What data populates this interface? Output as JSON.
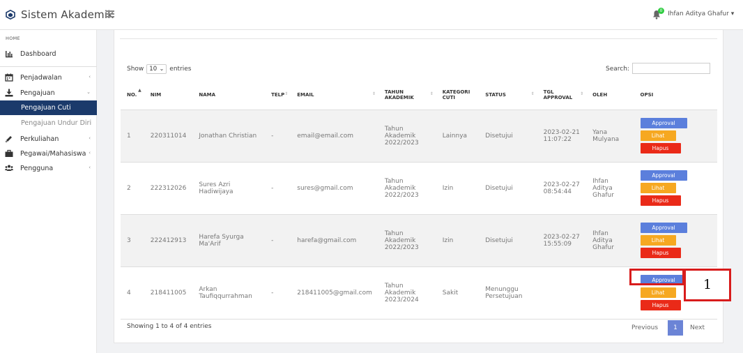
{
  "app": {
    "title": "Sistem Akademik",
    "brand_color": "#1b3a6b"
  },
  "user": {
    "name": "Ihfan Aditya Ghafur",
    "notification_count": "0"
  },
  "sidebar": {
    "heading": "HOME",
    "items": [
      {
        "label": "Dashboard",
        "icon": "bar-chart-icon"
      },
      {
        "label": "Penjadwalan",
        "icon": "calendar-icon"
      },
      {
        "label": "Pengajuan",
        "icon": "download-icon"
      },
      {
        "label": "Pengajuan Cuti",
        "active": true
      },
      {
        "label": "Pengajuan Undur Diri"
      },
      {
        "label": "Perkuliahan",
        "icon": "pencil-icon"
      },
      {
        "label": "Pegawai/Mahasiswa",
        "icon": "briefcase-icon"
      },
      {
        "label": "Pengguna",
        "icon": "users-icon"
      }
    ]
  },
  "table_controls": {
    "show_label": "Show",
    "show_value": "10",
    "entries_label": "entries",
    "search_label": "Search:"
  },
  "table": {
    "headers": {
      "no": "NO.",
      "nim": "NIM",
      "nama": "NAMA",
      "telp": "TELP",
      "email": "EMAIL",
      "tahun1": "TAHUN",
      "tahun2": "AKADEMIK",
      "kategori1": "KATEGORI",
      "kategori2": "CUTI",
      "status": "STATUS",
      "tgl1": "TGL",
      "tgl2": "APPROVAL",
      "oleh": "OLEH",
      "opsi": "OPSI"
    },
    "rows": [
      {
        "no": "1",
        "nim": "220311014",
        "nama1": "Jonathan Christian",
        "nama2": "",
        "telp": "-",
        "email": "email@email.com",
        "tahun1": "Tahun",
        "tahun2": "Akademik",
        "tahun3": "2022/2023",
        "kategori": "Lainnya",
        "status1": "Disetujui",
        "status2": "",
        "tgl1": "2023-02-21",
        "tgl2": "11:07:22",
        "oleh1": "Yana",
        "oleh2": "Mulyana",
        "oleh3": ""
      },
      {
        "no": "2",
        "nim": "222312026",
        "nama1": "Sures Azri",
        "nama2": "Hadiwijaya",
        "telp": "-",
        "email": "sures@gmail.com",
        "tahun1": "Tahun",
        "tahun2": "Akademik",
        "tahun3": "2022/2023",
        "kategori": "Izin",
        "status1": "Disetujui",
        "status2": "",
        "tgl1": "2023-02-27",
        "tgl2": "08:54:44",
        "oleh1": "Ihfan",
        "oleh2": "Aditya",
        "oleh3": "Ghafur"
      },
      {
        "no": "3",
        "nim": "222412913",
        "nama1": "Harefa Syurga",
        "nama2": "Ma'Arif",
        "telp": "-",
        "email": "harefa@gmail.com",
        "tahun1": "Tahun",
        "tahun2": "Akademik",
        "tahun3": "2022/2023",
        "kategori": "Izin",
        "status1": "Disetujui",
        "status2": "",
        "tgl1": "2023-02-27",
        "tgl2": "15:55:09",
        "oleh1": "Ihfan",
        "oleh2": "Aditya",
        "oleh3": "Ghafur"
      },
      {
        "no": "4",
        "nim": "218411005",
        "nama1": "Arkan",
        "nama2": "Taufiqqurrahman",
        "telp": "-",
        "email": "218411005@gmail.com",
        "tahun1": "Tahun",
        "tahun2": "Akademik",
        "tahun3": "2023/2024",
        "kategori": "Sakit",
        "status1": "Menunggu",
        "status2": "Persetujuan",
        "tgl1": "",
        "tgl2": "",
        "oleh1": "",
        "oleh2": "",
        "oleh3": ""
      }
    ],
    "buttons": {
      "approval": "Approval",
      "lihat": "Lihat",
      "hapus": "Hapus"
    }
  },
  "footer": {
    "info": "Showing 1 to 4 of 4 entries",
    "previous": "Previous",
    "page": "1",
    "next": "Next"
  },
  "annotation": {
    "label": "1",
    "color": "#d81c1c"
  }
}
